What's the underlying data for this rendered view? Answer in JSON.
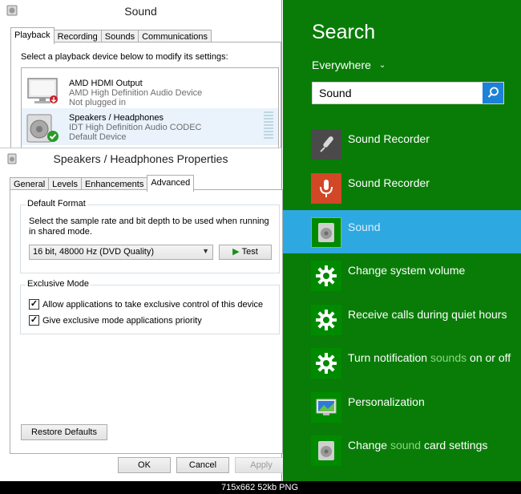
{
  "sound_window": {
    "title": "Sound",
    "tabs": [
      "Playback",
      "Recording",
      "Sounds",
      "Communications"
    ],
    "active_tab": "Playback",
    "instruction": "Select a playback device below to modify its settings:",
    "devices": [
      {
        "name": "AMD HDMI Output",
        "driver": "AMD High Definition Audio Device",
        "status": "Not plugged in",
        "icon": "monitor-icon"
      },
      {
        "name": "Speakers / Headphones",
        "driver": "IDT High Definition Audio CODEC",
        "status": "Default Device",
        "icon": "speaker-icon"
      }
    ]
  },
  "properties_window": {
    "title": "Speakers / Headphones Properties",
    "tabs": [
      "General",
      "Levels",
      "Enhancements",
      "Advanced"
    ],
    "active_tab": "Advanced",
    "default_format": {
      "group_label": "Default Format",
      "description": "Select the sample rate and bit depth to be used when running in shared mode.",
      "selected": "16 bit, 48000 Hz (DVD Quality)",
      "test_label": "Test"
    },
    "exclusive_mode": {
      "group_label": "Exclusive Mode",
      "options": [
        {
          "label": "Allow applications to take exclusive control of this device",
          "checked": true
        },
        {
          "label": "Give exclusive mode applications priority",
          "checked": true
        }
      ]
    },
    "restore_label": "Restore Defaults",
    "ok_label": "OK",
    "cancel_label": "Cancel",
    "apply_label": "Apply"
  },
  "search_charm": {
    "title": "Search",
    "scope": "Everywhere",
    "query": "Sound",
    "results": [
      {
        "label": "Sound Recorder",
        "icon": "microphone-dark-icon",
        "selected": false
      },
      {
        "label": "Sound Recorder",
        "icon": "microphone-red-icon",
        "selected": false
      },
      {
        "label": "Sound",
        "icon": "speaker-icon",
        "selected": true
      },
      {
        "label": "Change system volume",
        "icon": "gear-icon",
        "selected": false
      },
      {
        "label": "Receive calls during quiet hours",
        "icon": "gear-icon",
        "selected": false
      },
      {
        "label_before": "Turn notification ",
        "label_highlight": "sounds",
        "label_after": " on or off",
        "icon": "gear-icon",
        "selected": false
      },
      {
        "label": "Personalization",
        "icon": "personalization-icon",
        "selected": false
      },
      {
        "label_before": "Change ",
        "label_highlight": "sound",
        "label_after": " card settings",
        "icon": "speaker-icon",
        "selected": false
      }
    ],
    "colors": {
      "background": "#097c08",
      "selected": "#2ea8e0",
      "tile": "#008a00",
      "highlight": "#8bd77e"
    }
  },
  "image_caption": "715x662  52kb  PNG"
}
